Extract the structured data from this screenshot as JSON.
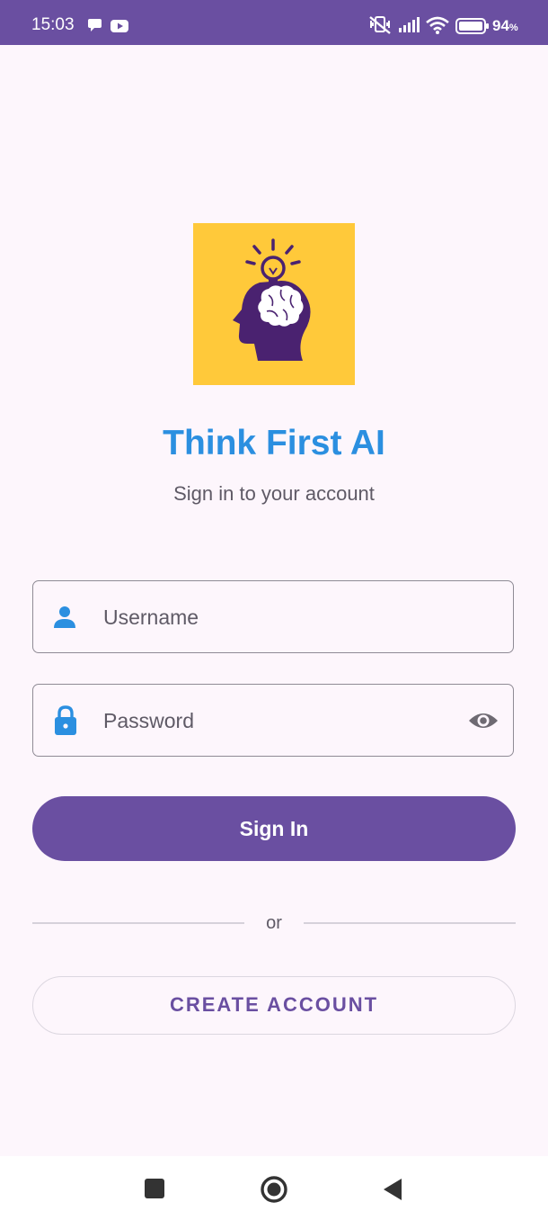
{
  "status_bar": {
    "time": "15:03",
    "battery_percent": "94",
    "battery_unit": "%",
    "icons": [
      "chat-notification-icon",
      "youtube-icon",
      "mute-vibrate-icon",
      "signal-icon",
      "wifi-icon",
      "battery-icon"
    ]
  },
  "app": {
    "title": "Think First AI",
    "subtitle": "Sign in to your account",
    "logo_icon": "brain-lightbulb-head-icon"
  },
  "form": {
    "username_placeholder": "Username",
    "password_placeholder": "Password",
    "username_icon": "person-icon",
    "password_icon": "lock-icon",
    "visibility_icon": "eye-icon"
  },
  "actions": {
    "sign_in_label": "Sign In",
    "divider_text": "or",
    "create_account_label": "CREATE ACCOUNT"
  },
  "nav": {
    "icons": [
      "recents-icon",
      "home-icon",
      "back-icon"
    ]
  },
  "colors": {
    "primary": "#6a4fa1",
    "title_blue": "#2b8fe0",
    "logo_background": "#ffc93a",
    "background": "#fdf6fc"
  }
}
